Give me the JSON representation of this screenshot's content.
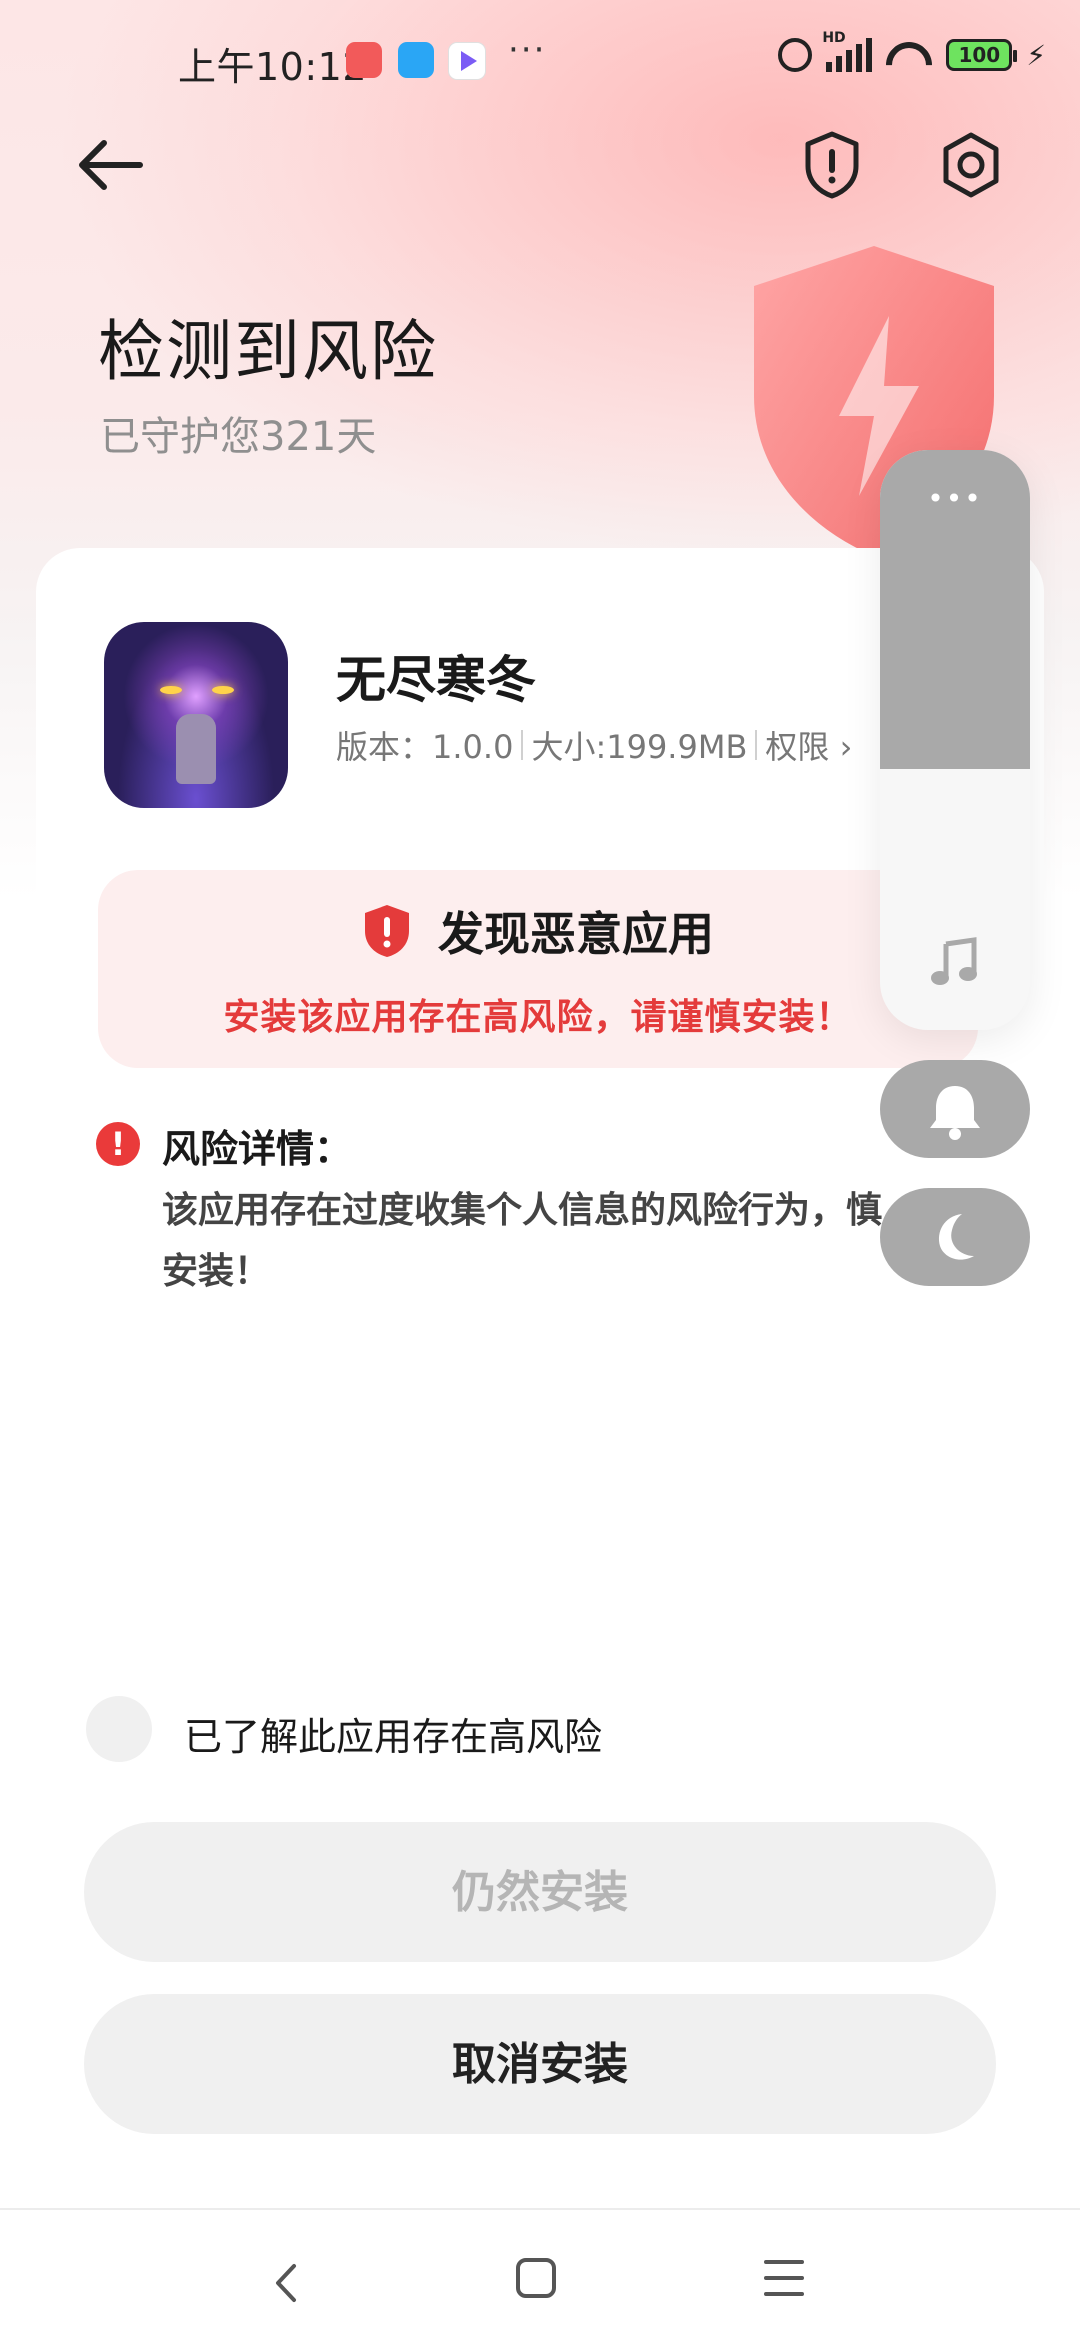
{
  "status_bar": {
    "time": "上午10:12",
    "more": "···",
    "network_label": "HD",
    "battery": "100"
  },
  "header": {
    "title": "检测到风险",
    "subtitle": "已守护您321天"
  },
  "app": {
    "name": "无尽寒冬",
    "version": "版本：1.0.0",
    "size": "大小:199.9MB",
    "permissions": "权限 ›"
  },
  "alert": {
    "title": "发现恶意应用",
    "message": "安装该应用存在高风险，请谨慎安装！"
  },
  "risk": {
    "title": "风险详情：",
    "body": "该应用存在过度收集个人信息的风险行为，慎安装！"
  },
  "floating_panel": {
    "dots": "•••",
    "volume_fraction": 0.55
  },
  "acknowledge": {
    "label": "已了解此应用存在高风险"
  },
  "buttons": {
    "install": "仍然安装",
    "cancel": "取消安装"
  },
  "colors": {
    "accent_red": "#e43b3b",
    "alert_bg": "#fdeeee",
    "button_bg": "#f0f0f0"
  }
}
